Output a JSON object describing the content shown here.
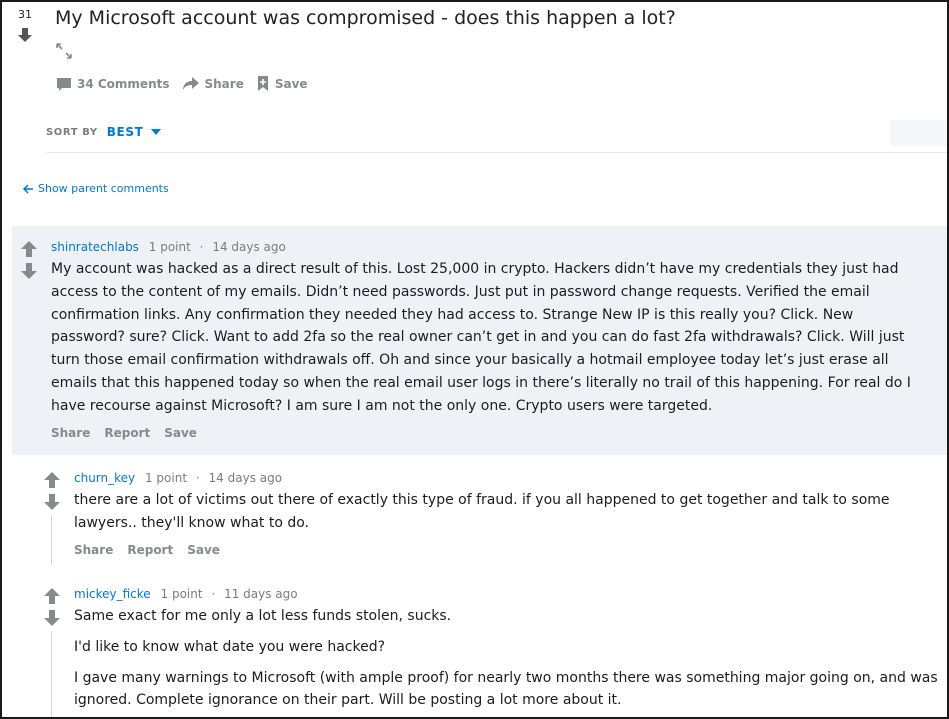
{
  "post": {
    "score": "31",
    "title": "My Microsoft account was compromised - does this happen a lot?",
    "actions": {
      "comments": "34 Comments",
      "share": "Share",
      "save": "Save"
    }
  },
  "sort": {
    "label": "SORT BY",
    "value": "BEST"
  },
  "show_parent": "Show parent comments",
  "comments": [
    {
      "author": "shinratechlabs",
      "points": "1 point",
      "sep": "·",
      "age": "14 days ago",
      "paragraphs": [
        "My account was hacked as a direct result of this. Lost 25,000 in crypto. Hackers didn’t have my credentials they just had access to the content of my emails. Didn’t need passwords. Just put in password change requests. Verified the email confirmation links. Any confirmation they needed they had access to. Strange New IP is this really you? Click. New password? sure? Click. Want to add 2fa so the real owner can’t get in and you can do fast 2fa withdrawals? Click. Will just turn those email confirmation withdrawals off. Oh and since your basically a hotmail employee today let’s just erase all emails that this happened today so when the real email user logs in there’s literally no trail of this happening. For real do I have recourse against Microsoft? I am sure I am not the only one. Crypto users were targeted."
      ],
      "actions": {
        "share": "Share",
        "report": "Report",
        "save": "Save"
      }
    },
    {
      "author": "churn_key",
      "points": "1 point",
      "sep": "·",
      "age": "14 days ago",
      "paragraphs": [
        "there are a lot of victims out there of exactly this type of fraud. if you all happened to get together and talk to some lawyers.. they'll know what to do."
      ],
      "actions": {
        "share": "Share",
        "report": "Report",
        "save": "Save"
      }
    },
    {
      "author": "mickey_ficke",
      "points": "1 point",
      "sep": "·",
      "age": "11 days ago",
      "paragraphs": [
        "Same exact for me only a lot less funds stolen, sucks.",
        "I'd like to know what date you were hacked?",
        "I gave many warnings to Microsoft (with ample proof) for nearly two months there was something major going on, and was ignored. Complete ignorance on their part. Will be posting a lot more about it."
      ]
    }
  ],
  "colors": {
    "link": "#0079d3",
    "meta": "#7c7c7c",
    "highlight_bg": "#eef2f7",
    "vote_arrow": "#878a8c"
  },
  "icons": {
    "upvote": "arrow-up-icon",
    "downvote": "arrow-down-icon",
    "expand": "expand-icon",
    "comments": "comment-bubble-icon",
    "share": "share-arrow-icon",
    "save": "bookmark-plus-icon",
    "sort": "caret-down-icon",
    "back": "arrow-left-icon"
  }
}
